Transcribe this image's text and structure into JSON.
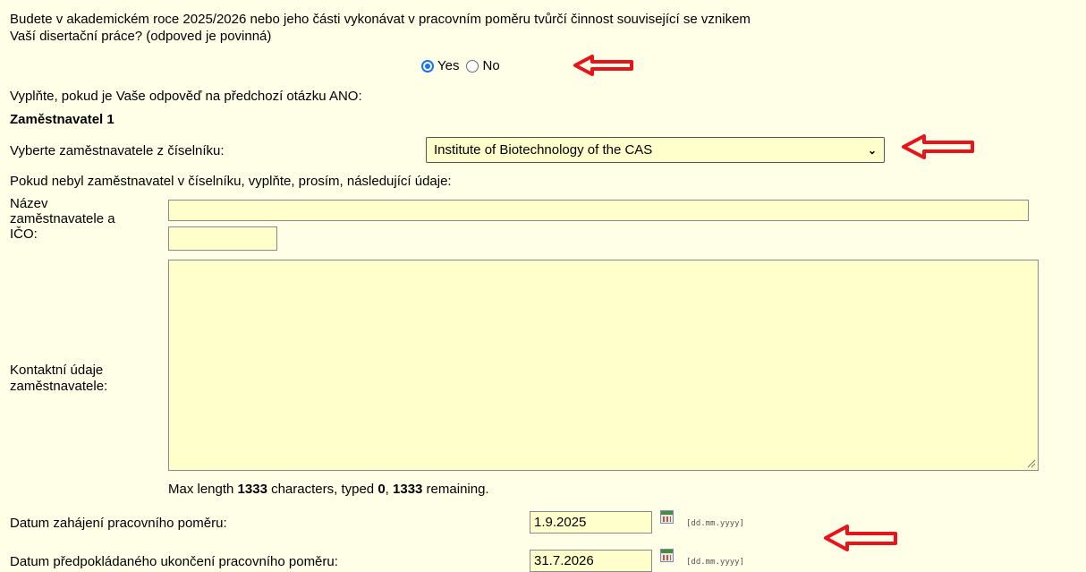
{
  "question": {
    "line1": "Budete v akademickém roce 2025/2026 nebo jeho části vykonávat v pracovním poměru tvůrčí činnost související se vznikem",
    "line2": "Vaší disertační práce? (odpoved je povinná)"
  },
  "radio": {
    "yes_label": "Yes",
    "no_label": "No",
    "selected": "Yes"
  },
  "instruction": "Vyplňte, pokud je Vaše odpověď na předchozí otázku ANO:",
  "employer_heading": "Zaměstnavatel 1",
  "select_label": "Vyberte zaměstnavatele z číselníku:",
  "select_value": "Institute of Biotechnology of the CAS",
  "fallback_text": "Pokud nebyl zaměstnavatel v číselníku, vyplňte, prosím, následující údaje:",
  "name_label": {
    "l1": "Název",
    "l2": "zaměstnavatele a",
    "l3": "IČO:"
  },
  "contact_label": {
    "l1": "Kontaktní údaje",
    "l2": "zaměstnavatele:"
  },
  "counter": {
    "prefix": "Max length ",
    "max": "1333",
    "mid": " characters, typed ",
    "typed": "0",
    "sep": ", ",
    "remaining": "1333",
    "suffix": " remaining."
  },
  "start_date": {
    "label": "Datum zahájení pracovního poměru:",
    "value": "1.9.2025",
    "format": "[dd.mm.yyyy]"
  },
  "end_date": {
    "label": "Datum předpokládaného ukončení pracovního poměru:",
    "value": "31.7.2026",
    "format": "[dd.mm.yyyy]"
  },
  "colors": {
    "field_bg": "#ffffcc",
    "page_bg": "#ffffe8",
    "arrow": "#e8141c"
  }
}
